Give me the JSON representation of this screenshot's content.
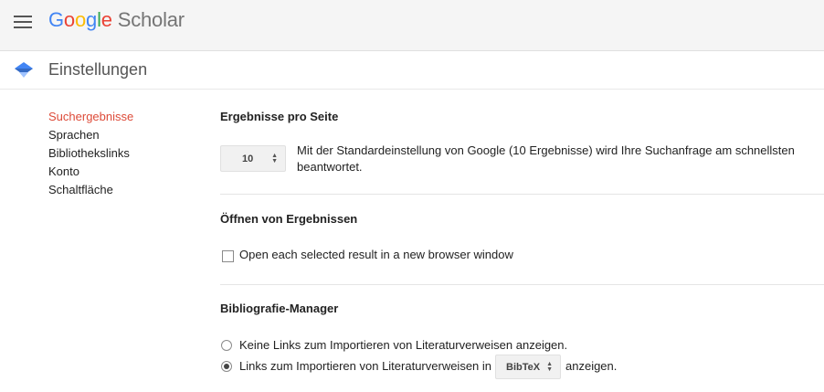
{
  "header": {
    "logo": {
      "letters": [
        {
          "char": "G",
          "color": "#4285f4"
        },
        {
          "char": "o",
          "color": "#ea4335"
        },
        {
          "char": "o",
          "color": "#fbbc05"
        },
        {
          "char": "g",
          "color": "#4285f4"
        },
        {
          "char": "l",
          "color": "#34a853"
        },
        {
          "char": "e",
          "color": "#ea4335"
        }
      ],
      "suffix": " Scholar"
    },
    "menu_icon": "hamburger-menu-icon"
  },
  "subheader": {
    "icon": "scholar-cap-icon",
    "title": "Einstellungen"
  },
  "sidebar": {
    "items": [
      {
        "label": "Suchergebnisse",
        "active": true
      },
      {
        "label": "Sprachen",
        "active": false
      },
      {
        "label": "Bibliothekslinks",
        "active": false
      },
      {
        "label": "Konto",
        "active": false
      },
      {
        "label": "Schaltfläche",
        "active": false
      }
    ]
  },
  "results_per_page": {
    "title": "Ergebnisse pro Seite",
    "selected_value": "10",
    "description_line1": "Mit der Standardeinstellung von Google (10 Ergebnisse) wird Ihre Suchanfrage am schnellsten",
    "description_line2": "beantwortet."
  },
  "open_results": {
    "title": "Öffnen von Ergebnissen",
    "checkbox_label": "Open each selected result in a new browser window",
    "checked": false
  },
  "bibliography": {
    "title": "Bibliografie-Manager",
    "option1_label": "Keine Links zum Importieren von Literaturverweisen anzeigen.",
    "option2_prefix": "Links zum Importieren von Literaturverweisen in",
    "option2_select": "BibTeX",
    "option2_suffix": "anzeigen.",
    "selected_option": 2
  },
  "colors": {
    "active_nav": "#dd4b39",
    "topbar_bg": "#f5f5f5",
    "scholar_blue": "#4285f4"
  }
}
